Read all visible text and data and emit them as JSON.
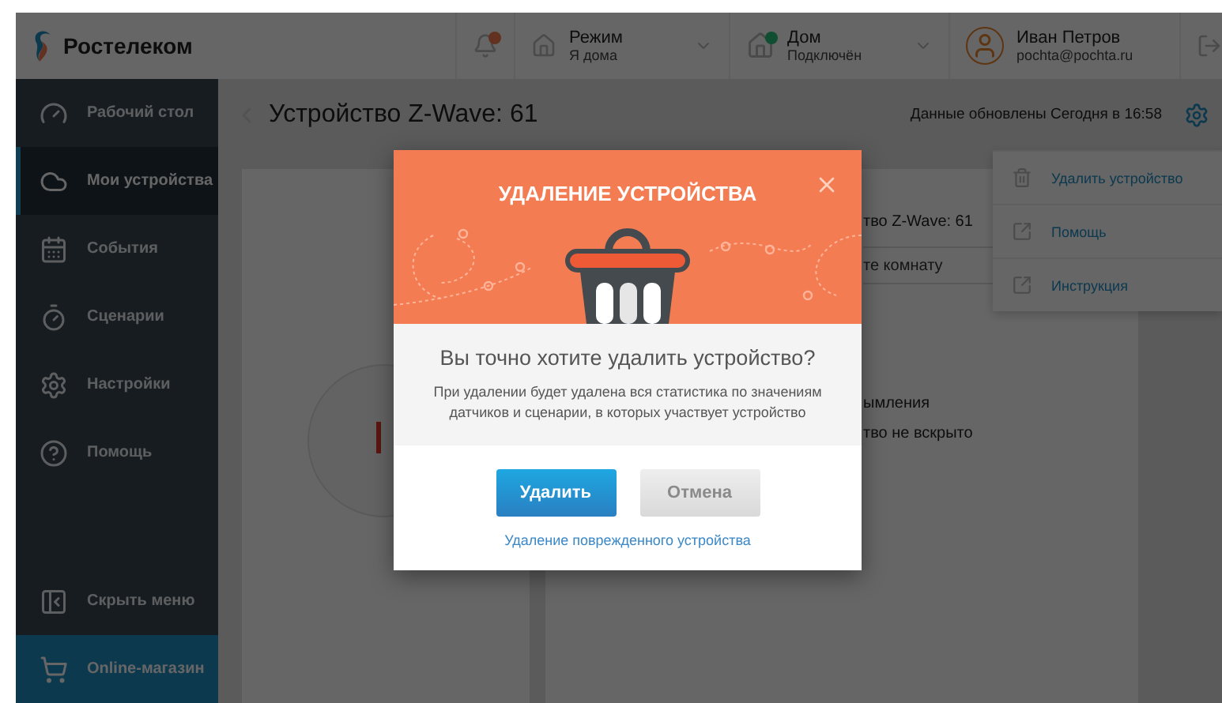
{
  "header": {
    "logo": "Ростелеком",
    "notifications": {
      "unread": true
    },
    "mode": {
      "label": "Режим",
      "value": "Я дома"
    },
    "home": {
      "label": "Дом",
      "status": "Подключён",
      "online": true
    },
    "user": {
      "name": "Иван Петров",
      "email": "pochta@pochta.ru"
    }
  },
  "sidebar": {
    "items": [
      {
        "label": "Рабочий стол",
        "kind": "dashboard",
        "selected": false
      },
      {
        "label": "Мои устройства",
        "kind": "devices",
        "selected": true
      },
      {
        "label": "События",
        "kind": "events",
        "selected": false
      },
      {
        "label": "Сценарии",
        "kind": "scenarios",
        "selected": false
      },
      {
        "label": "Настройки",
        "kind": "settings",
        "selected": false
      },
      {
        "label": "Помощь",
        "kind": "help",
        "selected": false
      }
    ],
    "hide_menu": "Скрыть меню",
    "shop": "Online-магазин"
  },
  "page": {
    "title": "Устройство Z-Wave: 61",
    "updated": "Данные обновлены Сегодня в 16:58"
  },
  "device_card": {
    "name": "тво Z-Wave: 61",
    "room_placeholder": "те комнату",
    "status_lines": [
      "ымления",
      "тво не вскрыто"
    ]
  },
  "menu": {
    "items": [
      {
        "label": "Удалить устройство",
        "kind": "delete"
      },
      {
        "label": "Помощь",
        "kind": "link"
      },
      {
        "label": "Инструкция",
        "kind": "link"
      }
    ]
  },
  "dialog": {
    "title": "УДАЛЕНИЕ УСТРОЙСТВА",
    "question": "Вы точно хотите удалить устройство?",
    "description": "При удалении будет удалена вся статистика по значениям датчиков и сценарии, в которых участвует устройство",
    "buttons": [
      {
        "label": "Удалить",
        "kind": "primary"
      },
      {
        "label": "Отмена",
        "kind": "secondary"
      }
    ],
    "link": "Удаление поврежденного устройства"
  }
}
